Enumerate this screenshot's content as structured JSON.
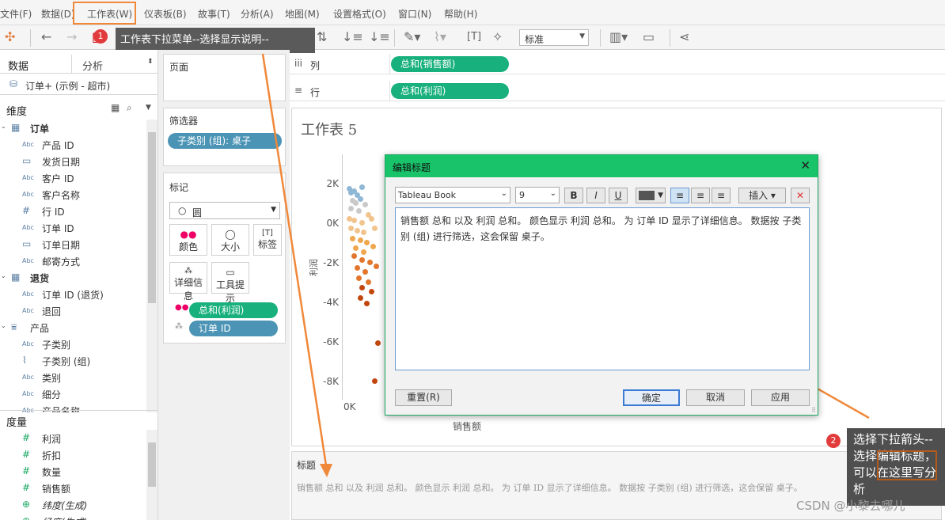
{
  "menu": [
    "文件(F)",
    "数据(D)",
    "工作表(W)",
    "仪表板(B)",
    "故事(T)",
    "分析(A)",
    "地图(M)",
    "设置格式(O)",
    "窗口(N)",
    "帮助(H)"
  ],
  "toolbar": {
    "standard_select": "标准",
    "highlight": "工作表下拉菜单--选择显示说明--",
    "marker_1": "1"
  },
  "left_panel": {
    "tabs": {
      "data": "数据",
      "analysis": "分析"
    },
    "datasource": "订单+ (示例 - 超市)",
    "dimensions_header": "维度",
    "dimension_rows": [
      {
        "icon": "table",
        "label": "订单",
        "bold": true
      },
      {
        "icon": "Abc",
        "label": "产品 ID"
      },
      {
        "icon": "cal",
        "label": "发货日期"
      },
      {
        "icon": "Abc",
        "label": "客户 ID"
      },
      {
        "icon": "Abc",
        "label": "客户名称"
      },
      {
        "icon": "#",
        "label": "行 ID"
      },
      {
        "icon": "Abc",
        "label": "订单 ID"
      },
      {
        "icon": "cal",
        "label": "订单日期"
      },
      {
        "icon": "Abc",
        "label": "邮寄方式"
      },
      {
        "icon": "table",
        "label": "退货",
        "bold": true
      },
      {
        "icon": "Abc",
        "label": "订单 ID (退货)"
      },
      {
        "icon": "Abc",
        "label": "退回"
      },
      {
        "icon": "hier",
        "label": "产品",
        "bold": false
      },
      {
        "icon": "Abc",
        "label": "子类别"
      },
      {
        "icon": "clip",
        "label": "子类别 (组)"
      },
      {
        "icon": "Abc",
        "label": "类别"
      },
      {
        "icon": "Abc",
        "label": "细分"
      },
      {
        "icon": "Abc",
        "label": "产品名称"
      }
    ],
    "measures_header": "度量",
    "measure_rows": [
      {
        "icon": "#",
        "label": "利润"
      },
      {
        "icon": "#",
        "label": "折扣"
      },
      {
        "icon": "#",
        "label": "数量"
      },
      {
        "icon": "#",
        "label": "销售额"
      },
      {
        "icon": "globe",
        "label": "纬度(生成)"
      },
      {
        "icon": "globe",
        "label": "经度(生成)"
      }
    ]
  },
  "shelves": {
    "pages_label": "页面",
    "filters_label": "筛选器",
    "filter_pill": "子类别 (组): 桌子",
    "marks_label": "标记",
    "mark_type": "圆",
    "mark_cards": [
      "颜色",
      "大小",
      "标签",
      "详细信息",
      "工具提示"
    ],
    "mark_pills": [
      "总和(利润)",
      "订单 ID"
    ],
    "columns_label": "列",
    "columns_pill": "总和(销售额)",
    "rows_label": "行",
    "rows_pill": "总和(利润)"
  },
  "sheet": {
    "title": "工作表 5",
    "y_axis_label": "利润",
    "x_axis_label": "销售额",
    "x_tick": "0K"
  },
  "chart_data": {
    "type": "scatter",
    "xlabel": "销售额",
    "ylabel": "利润",
    "y_ticks": [
      "2K",
      "0K",
      "-2K",
      "-4K",
      "-6K",
      "-8K"
    ],
    "x_ticks": [
      "0K"
    ],
    "points": [
      {
        "x": 0.1,
        "y": 1.8
      },
      {
        "x": 0.2,
        "y": 1.6
      },
      {
        "x": 0.4,
        "y": 1.7
      },
      {
        "x": 0.6,
        "y": 1.5
      },
      {
        "x": 0.9,
        "y": 1.9
      },
      {
        "x": 0.3,
        "y": 1.2
      },
      {
        "x": 0.5,
        "y": 1.1
      },
      {
        "x": 0.8,
        "y": 1.3
      },
      {
        "x": 1.1,
        "y": 1.0
      },
      {
        "x": 0.2,
        "y": 0.8
      },
      {
        "x": 0.7,
        "y": 0.7
      },
      {
        "x": 1.3,
        "y": 0.5
      },
      {
        "x": 0.1,
        "y": 0.3
      },
      {
        "x": 0.4,
        "y": 0.2
      },
      {
        "x": 0.9,
        "y": 0.1
      },
      {
        "x": 1.5,
        "y": 0.3
      },
      {
        "x": 0.2,
        "y": -0.2
      },
      {
        "x": 0.6,
        "y": -0.3
      },
      {
        "x": 1.0,
        "y": -0.4
      },
      {
        "x": 1.7,
        "y": -0.2
      },
      {
        "x": 0.3,
        "y": -0.7
      },
      {
        "x": 0.8,
        "y": -0.8
      },
      {
        "x": 1.2,
        "y": -0.9
      },
      {
        "x": 0.5,
        "y": -1.2
      },
      {
        "x": 1.0,
        "y": -1.4
      },
      {
        "x": 1.6,
        "y": -1.1
      },
      {
        "x": 0.4,
        "y": -1.6
      },
      {
        "x": 0.9,
        "y": -1.8
      },
      {
        "x": 1.4,
        "y": -1.9
      },
      {
        "x": 0.6,
        "y": -2.2
      },
      {
        "x": 1.1,
        "y": -2.4
      },
      {
        "x": 1.8,
        "y": -2.1
      },
      {
        "x": 0.7,
        "y": -2.7
      },
      {
        "x": 1.3,
        "y": -2.9
      },
      {
        "x": 0.9,
        "y": -3.2
      },
      {
        "x": 1.5,
        "y": -3.4
      },
      {
        "x": 0.8,
        "y": -3.7
      },
      {
        "x": 1.2,
        "y": -4.0
      },
      {
        "x": 1.9,
        "y": -6.0
      },
      {
        "x": 1.7,
        "y": -7.9
      }
    ]
  },
  "dialog": {
    "title": "编辑标题",
    "font": "Tableau Book",
    "size": "9",
    "bold": "B",
    "italic": "I",
    "underline": "U",
    "insert": "插入",
    "body": "销售额 总和 以及 利润 总和。 颜色显示 利润 总和。 为 订单 ID 显示了详细信息。 数据按 子类别 (组) 进行筛选，这会保留 桌子。",
    "reset": "重置(R)",
    "ok": "确定",
    "cancel": "取消",
    "apply": "应用"
  },
  "caption": {
    "label": "标题",
    "text": "销售额 总和 以及 利润 总和。 颜色显示 利润 总和。 为 订单 ID 显示了详细信息。 数据按 子类别 (组) 进行筛选，这会保留 桌子。"
  },
  "annotation2": {
    "marker": "2",
    "text": "选择下拉箭头--选择编辑标题，可以在这里写分析"
  },
  "watermark": "CSDN @小黎去哪儿",
  "colors": {
    "accent": "#18b07d",
    "pill_blue": "#4b94b5",
    "highlight_orange": "#f0883a",
    "dialog_green": "#19c36a"
  }
}
